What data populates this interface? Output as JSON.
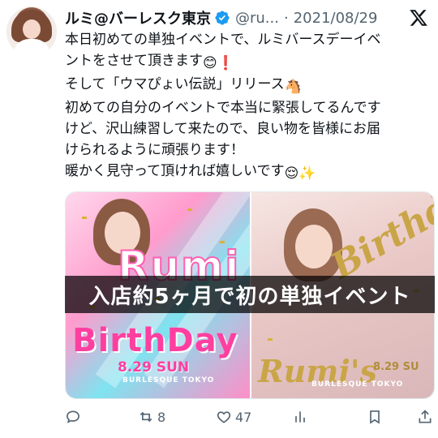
{
  "tweet": {
    "display_name": "ルミ@バーレスク東京",
    "handle": "@ru...",
    "separator": "·",
    "date": "2021/08/29",
    "lines": [
      "本日初めての単独イベントで、ルミバースデーイベ",
      "ントをさせて頂きます",
      "そして「ウマぴょい伝説」リリース",
      "初めての自分のイベントで本当に緊張してるんです",
      "けど、沢山練習して来たので、良い物を皆様にお届",
      "けられるように頑張ります！",
      "暖かく見守って頂ければ嬉しいです"
    ],
    "emojis": {
      "smile": "😊",
      "exclamation": "❗",
      "horse": "🐴",
      "relieved": "😌",
      "sparkles": "✨"
    }
  },
  "media": {
    "banner_text": "入店約5ヶ月で初の単独イベント",
    "left": {
      "title": "Rumi",
      "subtitle": "BirthDay",
      "date": "8.29 SUN",
      "venue": "BURLESQUE TOKYO"
    },
    "right": {
      "script_top": "Birthday",
      "script_bottom": "Rumi's",
      "date": "8.29 SU",
      "venue": "BURLESQUE TOKYO"
    }
  },
  "actions": {
    "reply_count": "",
    "retweet_count": "8",
    "like_count": "47",
    "views_count": ""
  },
  "colors": {
    "verified": "#1d9bf0",
    "muted": "#536471",
    "text": "#0f1419"
  }
}
